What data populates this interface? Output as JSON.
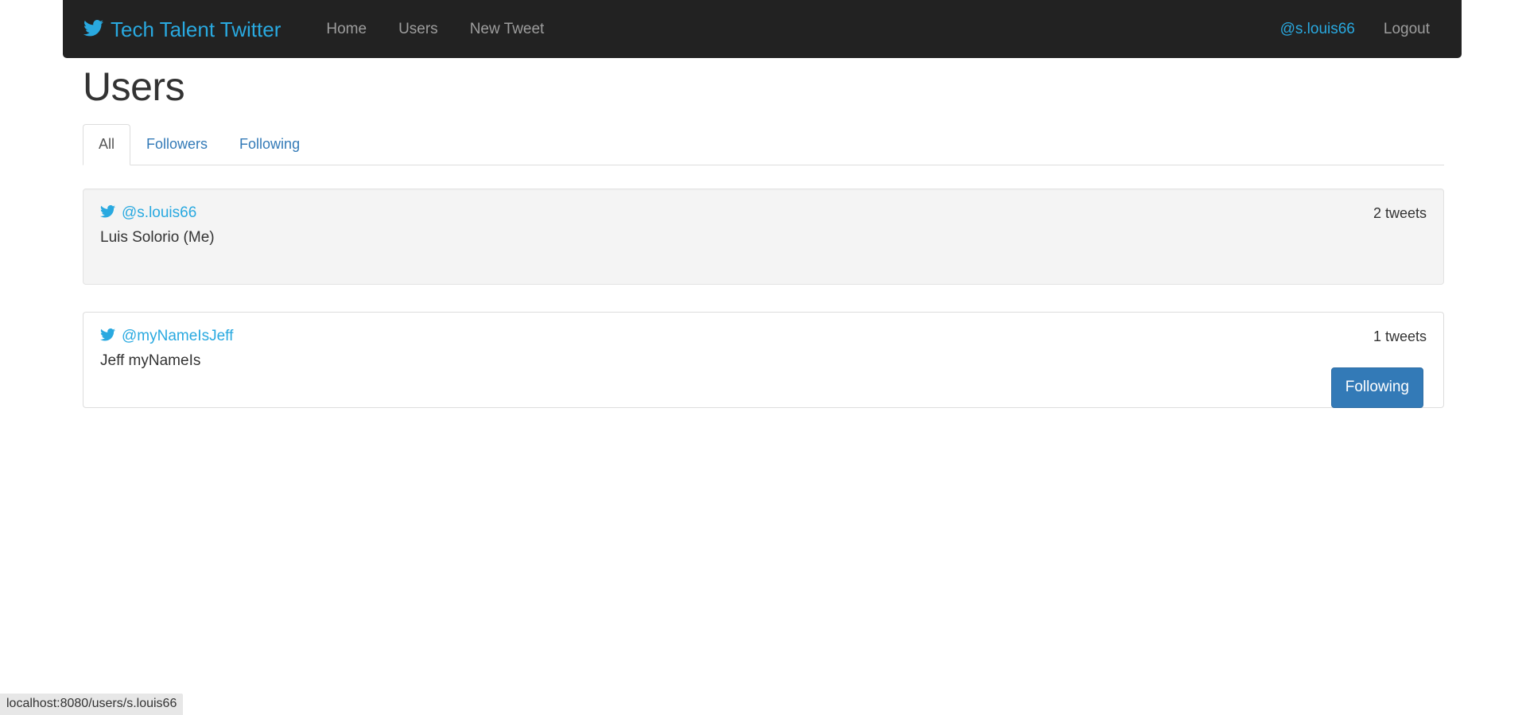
{
  "navbar": {
    "brand": "Tech Talent Twitter",
    "brand_icon": "twitter-bird-icon",
    "links": [
      {
        "label": "Home"
      },
      {
        "label": "Users"
      },
      {
        "label": "New Tweet"
      }
    ],
    "user_handle": "@s.louis66",
    "logout_label": "Logout"
  },
  "main": {
    "title": "Users",
    "tabs": [
      {
        "label": "All",
        "active": true
      },
      {
        "label": "Followers",
        "active": false
      },
      {
        "label": "Following",
        "active": false
      }
    ],
    "users": [
      {
        "handle": "@s.louis66",
        "fullname": "Luis Solorio (Me)",
        "tweets": "2 tweets",
        "highlight": true,
        "button": null
      },
      {
        "handle": "@myNameIsJeff",
        "fullname": "Jeff myNameIs",
        "tweets": "1 tweets",
        "highlight": false,
        "button": "Following"
      }
    ]
  },
  "status_bar": {
    "text": "localhost:8080/users/s.louis66"
  },
  "colors": {
    "navbar_bg": "#222222",
    "twitter_blue": "#29a9e0",
    "link_blue": "#337ab7",
    "button_blue": "#337ab7",
    "card_highlight_bg": "#f4f4f4",
    "text_dark": "#333333"
  }
}
